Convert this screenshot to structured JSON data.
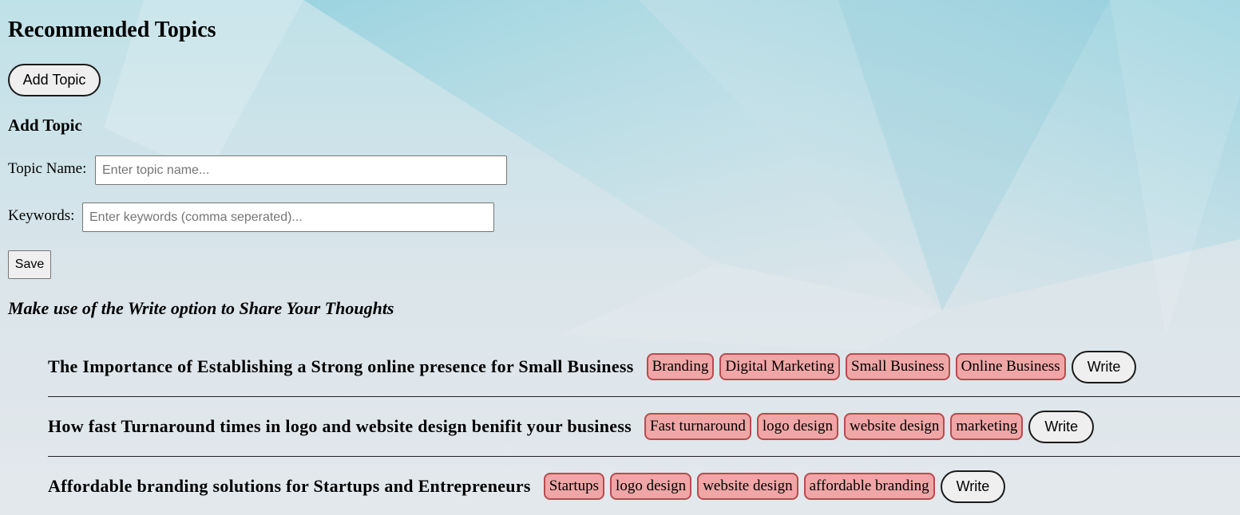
{
  "page": {
    "title": "Recommended Topics"
  },
  "toolbar": {
    "add_topic_label": "Add Topic"
  },
  "form": {
    "heading": "Add Topic",
    "topic_name_label": "Topic Name:",
    "topic_name_placeholder": "Enter topic name...",
    "topic_name_value": "",
    "keywords_label": "Keywords:",
    "keywords_placeholder": "Enter keywords (comma seperated)...",
    "keywords_value": "",
    "save_label": "Save"
  },
  "tagline": "Make use of the Write option to Share Your Thoughts",
  "topics": [
    {
      "title": "The Importance of Establishing a Strong online presence for Small Business",
      "tags": [
        "Branding",
        "Digital Marketing",
        "Small Business",
        "Online Business"
      ],
      "write_label": "Write"
    },
    {
      "title": "How fast Turnaround times in logo and website design benifit your business",
      "tags": [
        "Fast turnaround",
        "logo design",
        "website design",
        "marketing"
      ],
      "write_label": "Write"
    },
    {
      "title": "Affordable branding solutions for Startups and Entrepreneurs",
      "tags": [
        "Startups",
        "logo design",
        "website design",
        "affordable branding"
      ],
      "write_label": "Write"
    }
  ],
  "colors": {
    "tag_fill": "#f0a6a6",
    "tag_border": "#b94a4e",
    "background_base": "#e3e8ec",
    "background_accent": "#9fd3df"
  }
}
